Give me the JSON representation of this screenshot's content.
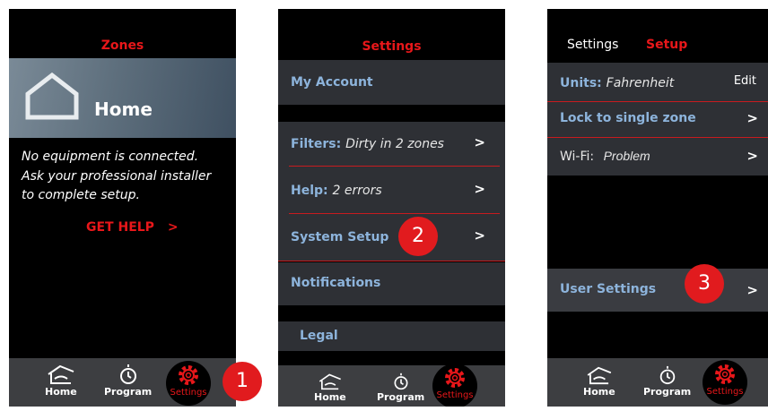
{
  "screen1": {
    "title": "Zones",
    "hero_label": "Home",
    "message_lines": [
      "No equipment is connected.",
      "Ask your professional installer",
      "to complete setup."
    ],
    "get_help": "GET HELP",
    "chevron": ">"
  },
  "screen2": {
    "title": "Settings",
    "my_account": "My Account",
    "filters_label": "Filters:",
    "filters_value": "Dirty in 2 zones",
    "help_label": "Help:",
    "help_value": "2 errors",
    "system_setup": "System Setup",
    "notifications": "Notifications",
    "legal": "Legal",
    "chevron": ">"
  },
  "screen3": {
    "breadcrumb": "Settings",
    "title": "Setup",
    "units_label": "Units:",
    "units_value": "Fahrenheit",
    "edit": "Edit",
    "lock_zone": "Lock to single zone",
    "wifi_label": "Wi-Fi:",
    "wifi_value": "Problem",
    "user_settings": "User Settings",
    "chevron": ">"
  },
  "nav": {
    "home": "Home",
    "program": "Program",
    "settings": "Settings"
  },
  "badges": [
    "1",
    "2",
    "3"
  ],
  "colors": {
    "accent_red": "#e8171a",
    "link_blue": "#8db4dc",
    "panel": "#2e3035",
    "nav_bar": "#3d3e41"
  },
  "icons": [
    "house-outline-icon",
    "house-icon",
    "stopwatch-icon",
    "gear-icon",
    "chevron-right-icon"
  ]
}
